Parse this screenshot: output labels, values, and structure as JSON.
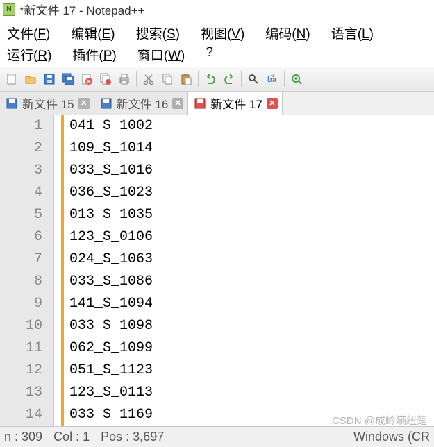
{
  "title": "*新文件 17 - Notepad++",
  "menu": {
    "file": "文件(F)",
    "edit": "编辑(E)",
    "search": "搜索(S)",
    "view": "视图(V)",
    "encoding": "编码(N)",
    "language": "语言(L)",
    "run": "运行(R)",
    "plugins": "插件(P)",
    "window": "窗口(W)",
    "help": "?"
  },
  "tabs": [
    {
      "label": "新文件 15",
      "modified": false
    },
    {
      "label": "新文件 16",
      "modified": false
    },
    {
      "label": "新文件 17",
      "modified": true,
      "active": true
    }
  ],
  "lines": [
    "041_S_1002",
    "109_S_1014",
    "033_S_1016",
    "036_S_1023",
    "013_S_1035",
    "123_S_0106",
    "024_S_1063",
    "033_S_1086",
    "141_S_1094",
    "033_S_1098",
    "062_S_1099",
    "051_S_1123",
    "123_S_0113",
    "033_S_1169"
  ],
  "status": {
    "ln_label": "n :",
    "ln": "309",
    "col_label": "Col :",
    "col": "1",
    "pos_label": "Pos :",
    "pos": "3,697",
    "os": "Windows (CR"
  },
  "watermark": "CSDN @成岭熵纽萣"
}
